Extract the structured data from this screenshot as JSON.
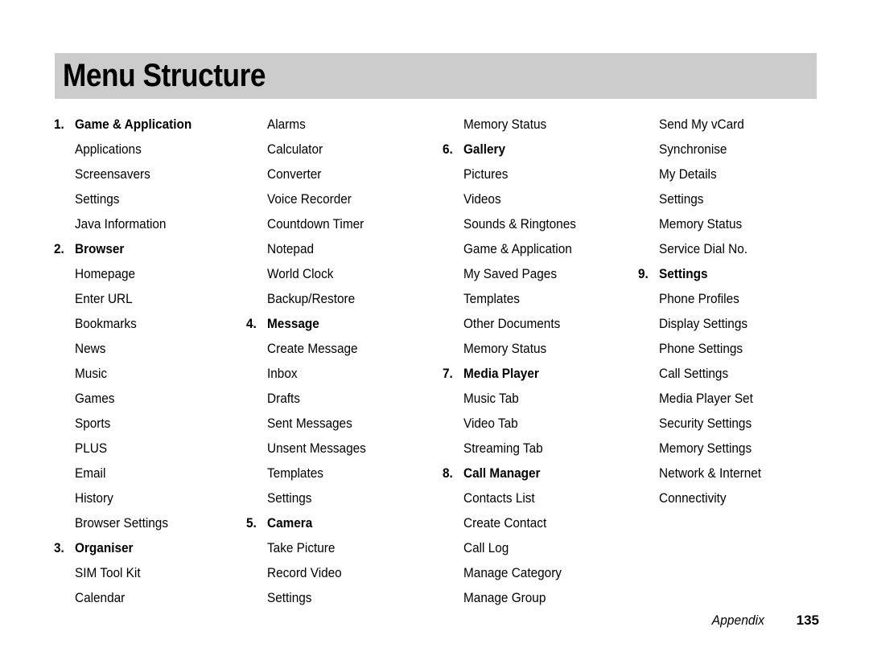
{
  "page": {
    "title": "Menu Structure",
    "banner_color": "#cccccc",
    "text_color": "#000000",
    "background_color": "#ffffff"
  },
  "footer": {
    "section_label": "Appendix",
    "page_number": "135"
  },
  "columns": [
    {
      "rows": [
        {
          "num": "1.",
          "label": "Game & Application",
          "section": true
        },
        {
          "num": "",
          "label": "Applications",
          "section": false
        },
        {
          "num": "",
          "label": "Screensavers",
          "section": false
        },
        {
          "num": "",
          "label": "Settings",
          "section": false
        },
        {
          "num": "",
          "label": "Java Information",
          "section": false
        },
        {
          "num": "2.",
          "label": "Browser",
          "section": true
        },
        {
          "num": "",
          "label": "Homepage",
          "section": false
        },
        {
          "num": "",
          "label": "Enter URL",
          "section": false
        },
        {
          "num": "",
          "label": "Bookmarks",
          "section": false
        },
        {
          "num": "",
          "label": "News",
          "section": false
        },
        {
          "num": "",
          "label": "Music",
          "section": false
        },
        {
          "num": "",
          "label": "Games",
          "section": false
        },
        {
          "num": "",
          "label": "Sports",
          "section": false
        },
        {
          "num": "",
          "label": "PLUS",
          "section": false
        },
        {
          "num": "",
          "label": "Email",
          "section": false
        },
        {
          "num": "",
          "label": "History",
          "section": false
        },
        {
          "num": "",
          "label": "Browser Settings",
          "section": false
        },
        {
          "num": "3.",
          "label": "Organiser",
          "section": true
        },
        {
          "num": "",
          "label": "SIM Tool Kit",
          "section": false
        },
        {
          "num": "",
          "label": "Calendar",
          "section": false
        }
      ]
    },
    {
      "rows": [
        {
          "num": "",
          "label": "Alarms",
          "section": false
        },
        {
          "num": "",
          "label": "Calculator",
          "section": false
        },
        {
          "num": "",
          "label": "Converter",
          "section": false
        },
        {
          "num": "",
          "label": "Voice Recorder",
          "section": false
        },
        {
          "num": "",
          "label": "Countdown Timer",
          "section": false
        },
        {
          "num": "",
          "label": "Notepad",
          "section": false
        },
        {
          "num": "",
          "label": "World Clock",
          "section": false
        },
        {
          "num": "",
          "label": "Backup/Restore",
          "section": false
        },
        {
          "num": "4.",
          "label": "Message",
          "section": true
        },
        {
          "num": "",
          "label": "Create Message",
          "section": false
        },
        {
          "num": "",
          "label": "Inbox",
          "section": false
        },
        {
          "num": "",
          "label": "Drafts",
          "section": false
        },
        {
          "num": "",
          "label": "Sent Messages",
          "section": false
        },
        {
          "num": "",
          "label": "Unsent Messages",
          "section": false
        },
        {
          "num": "",
          "label": "Templates",
          "section": false
        },
        {
          "num": "",
          "label": "Settings",
          "section": false
        },
        {
          "num": "5.",
          "label": "Camera",
          "section": true
        },
        {
          "num": "",
          "label": "Take Picture",
          "section": false
        },
        {
          "num": "",
          "label": "Record Video",
          "section": false
        },
        {
          "num": "",
          "label": "Settings",
          "section": false
        }
      ]
    },
    {
      "rows": [
        {
          "num": "",
          "label": "Memory Status",
          "section": false
        },
        {
          "num": "6.",
          "label": "Gallery",
          "section": true
        },
        {
          "num": "",
          "label": "Pictures",
          "section": false
        },
        {
          "num": "",
          "label": "Videos",
          "section": false
        },
        {
          "num": "",
          "label": "Sounds & Ringtones",
          "section": false
        },
        {
          "num": "",
          "label": "Game & Application",
          "section": false
        },
        {
          "num": "",
          "label": "My Saved Pages",
          "section": false
        },
        {
          "num": "",
          "label": "Templates",
          "section": false
        },
        {
          "num": "",
          "label": "Other Documents",
          "section": false
        },
        {
          "num": "",
          "label": "Memory Status",
          "section": false
        },
        {
          "num": "7.",
          "label": "Media Player",
          "section": true
        },
        {
          "num": "",
          "label": "Music Tab",
          "section": false
        },
        {
          "num": "",
          "label": "Video Tab",
          "section": false
        },
        {
          "num": "",
          "label": "Streaming Tab",
          "section": false
        },
        {
          "num": "8.",
          "label": "Call Manager",
          "section": true
        },
        {
          "num": "",
          "label": "Contacts List",
          "section": false
        },
        {
          "num": "",
          "label": "Create Contact",
          "section": false
        },
        {
          "num": "",
          "label": "Call Log",
          "section": false
        },
        {
          "num": "",
          "label": "Manage Category",
          "section": false
        },
        {
          "num": "",
          "label": "Manage Group",
          "section": false
        }
      ]
    },
    {
      "rows": [
        {
          "num": "",
          "label": "Send My vCard",
          "section": false
        },
        {
          "num": "",
          "label": "Synchronise",
          "section": false
        },
        {
          "num": "",
          "label": "My Details",
          "section": false
        },
        {
          "num": "",
          "label": "Settings",
          "section": false
        },
        {
          "num": "",
          "label": "Memory Status",
          "section": false
        },
        {
          "num": "",
          "label": "Service Dial No.",
          "section": false
        },
        {
          "num": "9.",
          "label": "Settings",
          "section": true
        },
        {
          "num": "",
          "label": "Phone Profiles",
          "section": false
        },
        {
          "num": "",
          "label": "Display Settings",
          "section": false
        },
        {
          "num": "",
          "label": "Phone Settings",
          "section": false
        },
        {
          "num": "",
          "label": "Call Settings",
          "section": false
        },
        {
          "num": "",
          "label": "Media Player Set",
          "section": false
        },
        {
          "num": "",
          "label": "Security Settings",
          "section": false
        },
        {
          "num": "",
          "label": "Memory Settings",
          "section": false
        },
        {
          "num": "",
          "label": "Network & Internet",
          "section": false
        },
        {
          "num": "",
          "label": "Connectivity",
          "section": false
        },
        {
          "num": "",
          "label": "",
          "section": false
        },
        {
          "num": "",
          "label": "",
          "section": false
        },
        {
          "num": "",
          "label": "",
          "section": false
        },
        {
          "num": "",
          "label": "",
          "section": false
        }
      ]
    }
  ]
}
